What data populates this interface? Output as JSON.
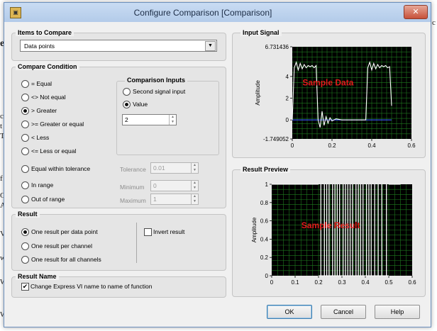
{
  "dialog": {
    "title": "Configure Comparison [Comparison]",
    "close_glyph": "✕",
    "app_icon": "labview-icon"
  },
  "background": {
    "left_glyphs": [
      "e",
      "c",
      "t",
      "T",
      "f",
      "C",
      "A",
      "V",
      "w",
      "W",
      "W"
    ],
    "right_glyph": "c"
  },
  "items_to_compare": {
    "title": "Items to Compare",
    "value": "Data points"
  },
  "compare_condition": {
    "title": "Compare Condition",
    "options": [
      "= Equal",
      "<> Not equal",
      "> Greater",
      ">= Greater or equal",
      "< Less",
      "<= Less or equal",
      "Equal within tolerance",
      "In range",
      "Out of range"
    ],
    "selected": "> Greater"
  },
  "comparison_inputs": {
    "title": "Comparison Inputs",
    "options": [
      "Second signal input",
      "Value"
    ],
    "selected": "Value",
    "value": "2"
  },
  "tolerance": {
    "label": "Tolerance",
    "value": "0.01"
  },
  "minimum": {
    "label": "Minimum",
    "value": "0"
  },
  "maximum": {
    "label": "Maximum",
    "value": "1"
  },
  "result": {
    "title": "Result",
    "options": [
      "One result per data point",
      "One result per channel",
      "One result for all channels"
    ],
    "selected": "One result per data point",
    "invert_label": "Invert result",
    "invert_checked": false
  },
  "result_name": {
    "title": "Result Name",
    "checkbox_label": "Change Express VI name to name of function",
    "checked": true
  },
  "buttons": {
    "ok": "OK",
    "cancel": "Cancel",
    "help": "Help"
  },
  "chart_data": [
    {
      "type": "line",
      "title": "Input Signal",
      "ylabel": "Amplitude",
      "watermark": "Sample Data",
      "xlim": [
        0,
        0.6
      ],
      "ylim": [
        -1.749052,
        6.731436
      ],
      "x_ticks": [
        "0",
        "0.2",
        "0.4",
        "0.6"
      ],
      "y_ticks": [
        "6.731436",
        "4",
        "2",
        "0",
        "-1.749052"
      ],
      "grid": true,
      "colors": {
        "plot_bg": "#000000",
        "grid": "#1f7a1f",
        "signal": "#ffffff",
        "reference": "#3b5bff",
        "watermark": "#e11b1b"
      },
      "series": [
        {
          "x": [
            0.0,
            0.01,
            0.02,
            0.03,
            0.04,
            0.05,
            0.06,
            0.07,
            0.08,
            0.09,
            0.1,
            0.11,
            0.12,
            0.13,
            0.14,
            0.15,
            0.16,
            0.17,
            0.18,
            0.19,
            0.2,
            0.22,
            0.25,
            0.28,
            0.31,
            0.34,
            0.37,
            0.38,
            0.39,
            0.4,
            0.41,
            0.42,
            0.43,
            0.44,
            0.45,
            0.46,
            0.47,
            0.48,
            0.49,
            0.5
          ],
          "y": [
            0.0,
            4.8,
            5.3,
            4.6,
            5.2,
            4.7,
            5.1,
            4.8,
            5.0,
            4.9,
            5.0,
            4.8,
            5.0,
            0.0,
            -0.7,
            0.8,
            -0.5,
            0.3,
            -0.3,
            0.2,
            -0.1,
            0.1,
            0.0,
            0.0,
            0.0,
            0.0,
            0.0,
            4.8,
            5.3,
            4.6,
            5.2,
            4.7,
            5.1,
            4.8,
            5.0,
            4.9,
            5.0,
            4.8,
            4.9,
            1.3
          ]
        },
        {
          "name": "reference",
          "x": [
            0.0,
            0.5
          ],
          "y": [
            0.0,
            0.0
          ]
        }
      ]
    },
    {
      "type": "line",
      "title": "Result Preview",
      "ylabel": "Amplitude",
      "watermark": "Sample Result",
      "xlim": [
        0,
        0.6
      ],
      "ylim": [
        0,
        1
      ],
      "x_ticks": [
        "0",
        "0.1",
        "0.2",
        "0.3",
        "0.4",
        "0.5",
        "0.6"
      ],
      "y_ticks": [
        "1",
        "0.8",
        "0.6",
        "0.4",
        "0.2",
        "0"
      ],
      "grid": true,
      "colors": {
        "plot_bg": "#000000",
        "grid": "#1f7a1f",
        "signal": "#ffffff",
        "watermark": "#e11b1b"
      },
      "series": [
        {
          "pulses_x": [
            0.21,
            0.225,
            0.235,
            0.245,
            0.26,
            0.27,
            0.28,
            0.29,
            0.305,
            0.315,
            0.325,
            0.335,
            0.345,
            0.36,
            0.37,
            0.38,
            0.39,
            0.405,
            0.415,
            0.425,
            0.44,
            0.455,
            0.47,
            0.49
          ],
          "high_segments": [
            [
              0.0,
              0.2
            ],
            [
              0.5,
              0.55
            ]
          ]
        }
      ]
    }
  ]
}
